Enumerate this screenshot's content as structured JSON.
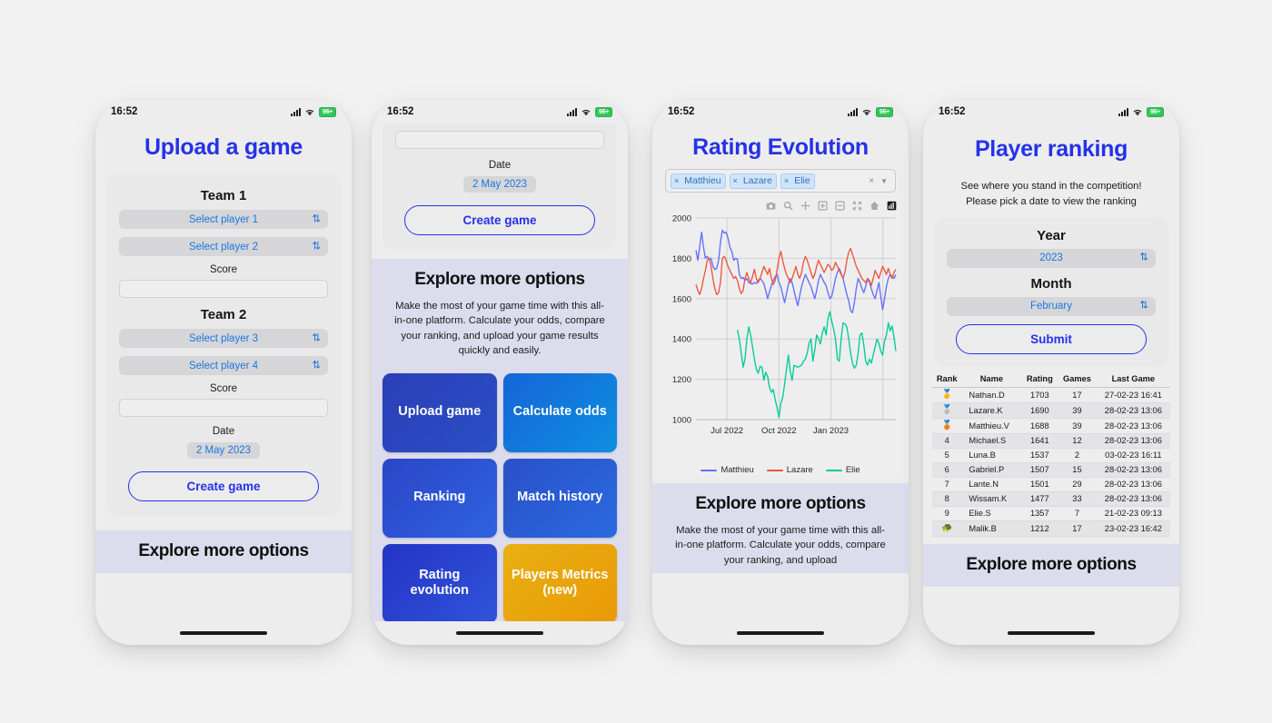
{
  "status_bar": {
    "time": "16:52",
    "battery": "96+",
    "cellular_icon": "signal-bars-icon",
    "wifi_icon": "wifi-icon",
    "battery_icon": "battery-icon"
  },
  "phone1": {
    "title": "Upload a game",
    "team1": {
      "heading": "Team 1",
      "player1": "Select player 1",
      "player2": "Select player 2",
      "score_label": "Score",
      "score_value": ""
    },
    "team2": {
      "heading": "Team 2",
      "player3": "Select player 3",
      "player4": "Select player 4",
      "score_label": "Score",
      "score_value": ""
    },
    "date_label": "Date",
    "date_value": "2 May 2023",
    "create_button": "Create game",
    "explore_heading": "Explore more options"
  },
  "phone2": {
    "date_label": "Date",
    "date_value": "2 May 2023",
    "create_button": "Create game",
    "explore_heading": "Explore more options",
    "explore_text": "Make the most of your game time with this all-in-one platform. Calculate your odds, compare your ranking, and upload your game results quickly and easily.",
    "tiles": [
      {
        "label": "Upload game",
        "color_from": "#2a3fb8",
        "color_to": "#2a4fc4"
      },
      {
        "label": "Calculate odds",
        "color_from": "#1565d8",
        "color_to": "#0d8fe0"
      },
      {
        "label": "Ranking",
        "color_from": "#2a46c8",
        "color_to": "#2f62e0"
      },
      {
        "label": "Match history",
        "color_from": "#2a50c8",
        "color_to": "#2a6ae0"
      },
      {
        "label": "Rating evolution",
        "color_from": "#2434c4",
        "color_to": "#2f54dc"
      },
      {
        "label": "Players Metrics (new)",
        "color_from": "#e8b013",
        "color_to": "#e99a06"
      }
    ]
  },
  "phone3": {
    "title": "Rating Evolution",
    "selected_players": [
      "Matthieu",
      "Lazare",
      "Elie"
    ],
    "multiselect_clear_icon": "clear-all-icon",
    "multiselect_dropdown_icon": "chevron-down-icon",
    "modebar": [
      "camera-icon",
      "zoom-icon",
      "pan-icon",
      "zoom-in-icon",
      "zoom-out-icon",
      "autoscale-icon",
      "home-icon",
      "plotly-logo-icon"
    ],
    "explore_heading": "Explore more options",
    "explore_text": "Make the most of your game time with this all-in-one platform. Calculate your odds, compare your ranking, and upload",
    "chart_data": {
      "type": "line",
      "title": "",
      "xlabel": "",
      "ylabel": "",
      "ylim": [
        1000,
        2000
      ],
      "yticks": [
        1000,
        1200,
        1400,
        1600,
        1800,
        2000
      ],
      "xticks": [
        "Jul 2022",
        "Oct 2022",
        "Jan 2023"
      ],
      "grid": true,
      "legend_position": "bottom",
      "series": [
        {
          "name": "Matthieu",
          "color": "#636efa",
          "values": [
            1840,
            1790,
            1860,
            1930,
            1855,
            1800,
            1810,
            1795,
            1800,
            1760,
            1745,
            1750,
            1790,
            1880,
            1940,
            1925,
            1930,
            1900,
            1855,
            1835,
            1790,
            1800,
            1795,
            1720,
            1700,
            1705,
            1690,
            1700,
            1680,
            1675,
            1672,
            1680,
            1675,
            1690,
            1700,
            1690,
            1675,
            1640,
            1600,
            1635,
            1665,
            1690,
            1710,
            1720,
            1680,
            1660,
            1620,
            1580,
            1625,
            1670,
            1700,
            1680,
            1640,
            1600,
            1565,
            1615,
            1660,
            1690,
            1720,
            1700,
            1680,
            1660,
            1630,
            1600,
            1640,
            1690,
            1720,
            1700,
            1680,
            1665,
            1630,
            1600,
            1610,
            1655,
            1700,
            1730,
            1750,
            1725,
            1700,
            1660,
            1620,
            1590,
            1540,
            1530,
            1580,
            1650,
            1700,
            1680,
            1650,
            1630,
            1660,
            1700,
            1680,
            1650,
            1620,
            1600,
            1640,
            1680,
            1610,
            1545,
            1600,
            1660,
            1700,
            1720,
            1710,
            1700,
            1720
          ]
        },
        {
          "name": "Lazare",
          "color": "#ef553b",
          "values": [
            1670,
            1640,
            1620,
            1650,
            1700,
            1740,
            1790,
            1800,
            1760,
            1700,
            1650,
            1620,
            1630,
            1680,
            1800,
            1810,
            1790,
            1760,
            1740,
            1720,
            1700,
            1710,
            1690,
            1650,
            1625,
            1640,
            1700,
            1730,
            1700,
            1680,
            1710,
            1745,
            1700,
            1680,
            1700,
            1730,
            1760,
            1740,
            1720,
            1750,
            1700,
            1670,
            1690,
            1740,
            1800,
            1835,
            1790,
            1750,
            1720,
            1700,
            1680,
            1700,
            1730,
            1760,
            1720,
            1700,
            1730,
            1780,
            1810,
            1790,
            1760,
            1730,
            1700,
            1720,
            1760,
            1790,
            1770,
            1750,
            1730,
            1750,
            1770,
            1760,
            1740,
            1750,
            1780,
            1760,
            1740,
            1720,
            1700,
            1730,
            1790,
            1830,
            1850,
            1820,
            1790,
            1760,
            1740,
            1720,
            1700,
            1690,
            1680,
            1700,
            1690,
            1665,
            1700,
            1740,
            1720,
            1700,
            1730,
            1760,
            1740,
            1720,
            1750,
            1720,
            1700,
            1730,
            1745
          ]
        },
        {
          "name": "Elie",
          "color": "#00cc96",
          "values": [
            null,
            null,
            null,
            null,
            null,
            null,
            null,
            null,
            null,
            null,
            null,
            null,
            null,
            null,
            null,
            null,
            null,
            null,
            null,
            null,
            null,
            null,
            1445,
            1400,
            1330,
            1260,
            1300,
            1400,
            1460,
            1420,
            1360,
            1300,
            1250,
            1230,
            1265,
            1260,
            1195,
            1235,
            1215,
            1160,
            1135,
            1150,
            1100,
            1060,
            1010,
            1080,
            1110,
            1175,
            1250,
            1320,
            1240,
            1195,
            1270,
            1265,
            1260,
            1265,
            1270,
            1290,
            1300,
            1330,
            1380,
            1400,
            1290,
            1345,
            1420,
            1400,
            1375,
            1430,
            1460,
            1420,
            1500,
            1535,
            1490,
            1450,
            1400,
            1300,
            1290,
            1400,
            1480,
            1475,
            1460,
            1400,
            1330,
            1280,
            1255,
            1270,
            1330,
            1420,
            1430,
            1370,
            1290,
            1270,
            1300,
            1280,
            1320,
            1360,
            1400,
            1380,
            1340,
            1320,
            1390,
            1420,
            1480,
            1440,
            1465,
            1410,
            1340
          ]
        }
      ]
    }
  },
  "phone4": {
    "title": "Player ranking",
    "subtitle_line1": "See where you stand in the competition!",
    "subtitle_line2": "Please pick a date to view the ranking",
    "year_label": "Year",
    "year_value": "2023",
    "month_label": "Month",
    "month_value": "February",
    "submit_button": "Submit",
    "explore_heading": "Explore more options",
    "table": {
      "headers": [
        "Rank",
        "Name",
        "Rating",
        "Games",
        "Last Game"
      ],
      "rows": [
        {
          "rank": "1",
          "rank_icon": "gold-medal-icon",
          "name": "Nathan.D",
          "rating": "1703",
          "games": "17",
          "last_game": "27-02-23 16:41"
        },
        {
          "rank": "2",
          "rank_icon": "silver-medal-icon",
          "name": "Lazare.K",
          "rating": "1690",
          "games": "39",
          "last_game": "28-02-23 13:06"
        },
        {
          "rank": "3",
          "rank_icon": "bronze-medal-icon",
          "name": "Matthieu.V",
          "rating": "1688",
          "games": "39",
          "last_game": "28-02-23 13:06"
        },
        {
          "rank": "4",
          "rank_icon": "",
          "name": "Michael.S",
          "rating": "1641",
          "games": "12",
          "last_game": "28-02-23 13:06"
        },
        {
          "rank": "5",
          "rank_icon": "",
          "name": "Luna.B",
          "rating": "1537",
          "games": "2",
          "last_game": "03-02-23 16:11"
        },
        {
          "rank": "6",
          "rank_icon": "",
          "name": "Gabriel.P",
          "rating": "1507",
          "games": "15",
          "last_game": "28-02-23 13:06"
        },
        {
          "rank": "7",
          "rank_icon": "",
          "name": "Lante.N",
          "rating": "1501",
          "games": "29",
          "last_game": "28-02-23 13:06"
        },
        {
          "rank": "8",
          "rank_icon": "",
          "name": "Wissam.K",
          "rating": "1477",
          "games": "33",
          "last_game": "28-02-23 13:06"
        },
        {
          "rank": "9",
          "rank_icon": "",
          "name": "Elie.S",
          "rating": "1357",
          "games": "7",
          "last_game": "21-02-23 09:13"
        },
        {
          "rank": "",
          "rank_icon": "turtle-icon",
          "name": "Malik.B",
          "rating": "1212",
          "games": "17",
          "last_game": "23-02-23 16:42"
        }
      ]
    }
  }
}
